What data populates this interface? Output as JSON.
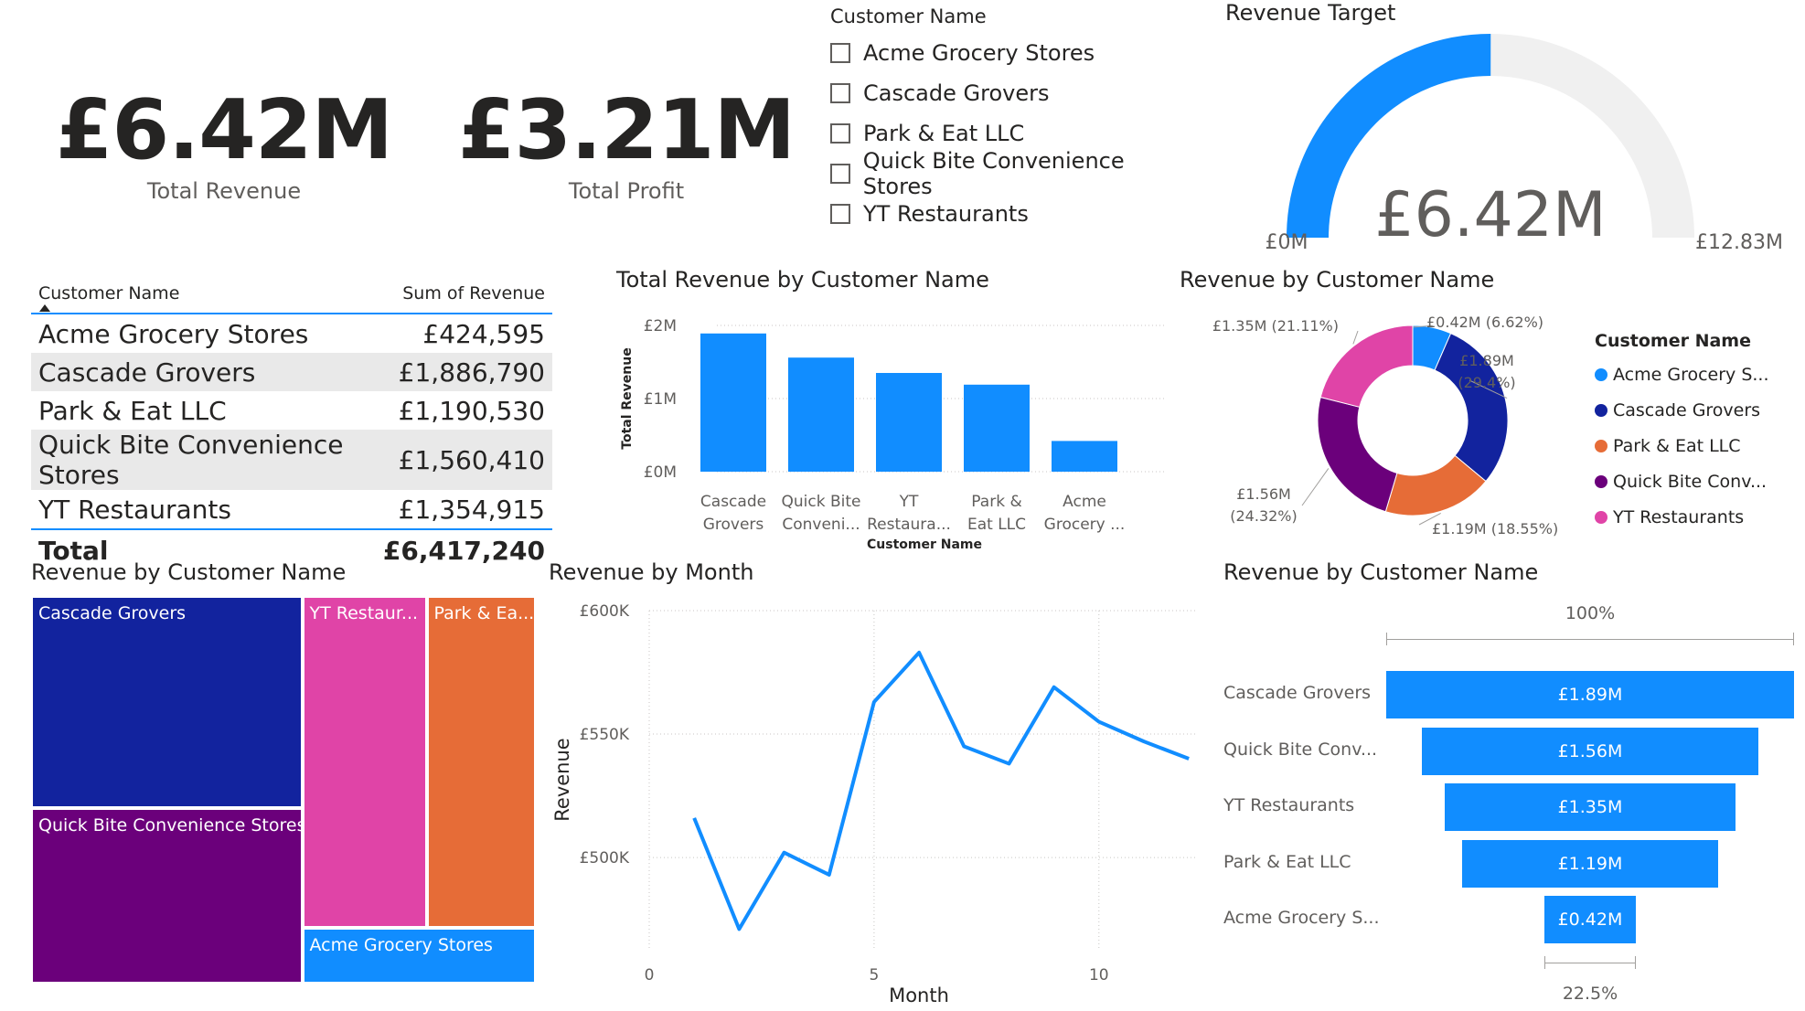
{
  "kpis": {
    "total_revenue": {
      "value": "£6.42M",
      "label": "Total Revenue"
    },
    "total_profit": {
      "value": "£3.21M",
      "label": "Total Profit"
    }
  },
  "slicer": {
    "title": "Customer Name",
    "items": [
      "Acme Grocery Stores",
      "Cascade Grovers",
      "Park & Eat LLC",
      "Quick Bite Convenience Stores",
      "YT Restaurants"
    ]
  },
  "gauge": {
    "title": "Revenue Target",
    "value_label": "£6.42M",
    "min_label": "£0M",
    "max_label": "£12.83M",
    "value": 6.42,
    "min": 0,
    "max": 12.83,
    "colors": {
      "fill": "#118dff",
      "track": "#f0f0f0"
    }
  },
  "matrix": {
    "headers": [
      "Customer Name",
      "Sum of Revenue"
    ],
    "rows": [
      {
        "name": "Acme Grocery Stores",
        "value": "£424,595"
      },
      {
        "name": "Cascade Grovers",
        "value": "£1,886,790"
      },
      {
        "name": "Park & Eat LLC",
        "value": "£1,190,530"
      },
      {
        "name": "Quick Bite Convenience Stores",
        "value": "£1,560,410"
      },
      {
        "name": "YT Restaurants",
        "value": "£1,354,915"
      }
    ],
    "total_label": "Total",
    "total_value": "£6,417,240"
  },
  "colors": {
    "accent": "#118dff",
    "acme": "#118dff",
    "cascade": "#12239e",
    "park": "#e66c37",
    "quick": "#6b007b",
    "yt": "#e044a7"
  },
  "chart_data": [
    {
      "type": "bar",
      "title": "Total Revenue by Customer Name",
      "xlabel": "Customer Name",
      "ylabel": "Total Revenue",
      "categories": [
        "Cascade Grovers",
        "Quick Bite Conveni...",
        "YT Restaura...",
        "Park & Eat LLC",
        "Acme Grocery ..."
      ],
      "category_lines": [
        [
          "Cascade",
          "Grovers"
        ],
        [
          "Quick Bite",
          "Conveni..."
        ],
        [
          "YT",
          "Restaura..."
        ],
        [
          "Park &",
          "Eat LLC"
        ],
        [
          "Acme",
          "Grocery ..."
        ]
      ],
      "values": [
        1.89,
        1.56,
        1.35,
        1.19,
        0.42
      ],
      "yticks": [
        "£0M",
        "£1M",
        "£2M"
      ],
      "ytick_values": [
        0,
        1,
        2
      ],
      "ylim": [
        0,
        2
      ],
      "unit": "£M",
      "grid": true
    },
    {
      "type": "pie",
      "title": "Revenue by Customer Name",
      "legend_title": "Customer Name",
      "legend_position": "right",
      "legend": [
        "Acme Grocery S...",
        "Cascade Grovers",
        "Park & Eat LLC",
        "Quick Bite Conv...",
        "YT Restaurants"
      ],
      "slices": [
        {
          "name": "Acme Grocery Stores",
          "value": 0.42,
          "percent": 6.62,
          "label_lines": [
            "£0.42M (6.62%)"
          ]
        },
        {
          "name": "Cascade Grovers",
          "value": 1.89,
          "percent": 29.4,
          "label_lines": [
            "£1.89M",
            "(29.4%)"
          ]
        },
        {
          "name": "Park & Eat LLC",
          "value": 1.19,
          "percent": 18.55,
          "label_lines": [
            "£1.19M (18.55%)"
          ]
        },
        {
          "name": "Quick Bite Convenience Stores",
          "value": 1.56,
          "percent": 24.32,
          "label_lines": [
            "£1.56M",
            "(24.32%)"
          ]
        },
        {
          "name": "YT Restaurants",
          "value": 1.35,
          "percent": 21.11,
          "label_lines": [
            "£1.35M (21.11%)"
          ]
        }
      ]
    },
    {
      "type": "treemap",
      "title": "Revenue by Customer Name",
      "items": [
        {
          "label": "Cascade Grovers",
          "value": 1886790
        },
        {
          "label": "Quick Bite Convenience Stores",
          "value": 1560410
        },
        {
          "label": "YT Restaur...",
          "value": 1354915
        },
        {
          "label": "Park & Ea...",
          "value": 1190530
        },
        {
          "label": "Acme Grocery Stores",
          "value": 424595
        }
      ]
    },
    {
      "type": "line",
      "title": "Revenue by Month",
      "xlabel": "Month",
      "ylabel": "Revenue",
      "x": [
        1,
        2,
        3,
        4,
        5,
        6,
        7,
        8,
        9,
        10,
        11,
        12
      ],
      "y": [
        516,
        471,
        502,
        493,
        563,
        583,
        545,
        538,
        569,
        555,
        547,
        540
      ],
      "unit": "£K",
      "xlim": [
        0,
        12.2
      ],
      "ylim": [
        463,
        600
      ],
      "xticks": [
        "0",
        "5",
        "10"
      ],
      "xtick_values": [
        0,
        5,
        10
      ],
      "yticks": [
        "£500K",
        "£550K",
        "£600K"
      ],
      "ytick_values": [
        500,
        550,
        600
      ],
      "grid": true
    },
    {
      "type": "funnel",
      "title": "Revenue by Customer Name",
      "top_label": "100%",
      "bottom_label": "22.5%",
      "stages": [
        {
          "name": "Cascade Grovers",
          "value": 1.89,
          "label": "£1.89M"
        },
        {
          "name": "Quick Bite Conv...",
          "value": 1.56,
          "label": "£1.56M"
        },
        {
          "name": "YT Restaurants",
          "value": 1.35,
          "label": "£1.35M"
        },
        {
          "name": "Park & Eat LLC",
          "value": 1.19,
          "label": "£1.19M"
        },
        {
          "name": "Acme Grocery S...",
          "value": 0.42,
          "label": "£0.42M"
        }
      ]
    }
  ]
}
